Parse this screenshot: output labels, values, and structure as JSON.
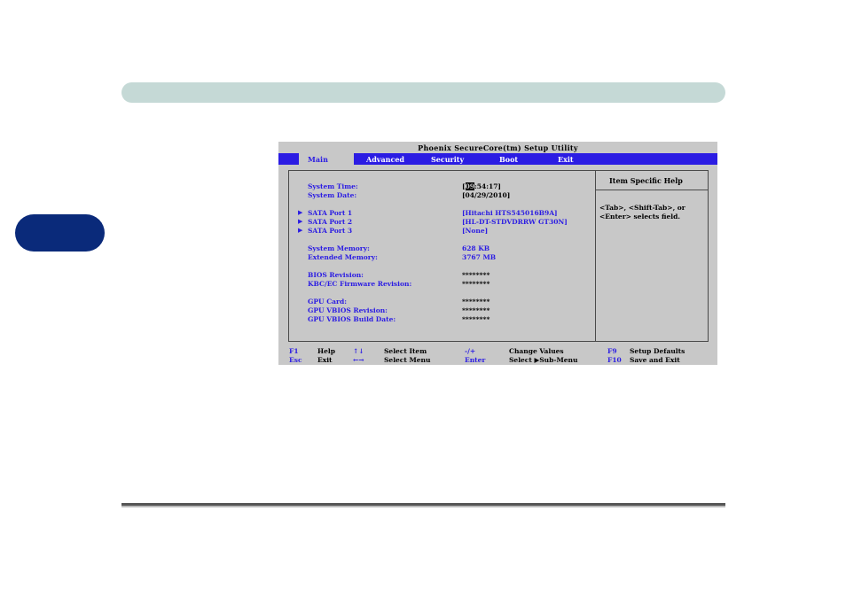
{
  "bios": {
    "title": "Phoenix SecureCore(tm) Setup Utility",
    "menu": [
      "Main",
      "Advanced",
      "Security",
      "Boot",
      "Exit"
    ],
    "active_menu": "Main",
    "help": {
      "title": "Item Specific Help",
      "text": "<Tab>, <Shift-Tab>, or <Enter> selects field."
    },
    "rows": [
      {
        "label": "System Time:",
        "value_hl": "09",
        "value_rest": ":54:17]",
        "value_prefix": "["
      },
      {
        "label": "System Date:",
        "value": "[04/29/2010]"
      },
      {
        "label": "SATA Port 1",
        "value": "[Hitachi HTS545016B9A]",
        "submenu": true
      },
      {
        "label": "SATA Port 2",
        "value": "[HL-DT-STDVDRRW GT30N]",
        "submenu": true
      },
      {
        "label": "SATA Port 3",
        "value": "[None]",
        "submenu": true
      },
      {
        "label": "System Memory:",
        "value": "628 KB"
      },
      {
        "label": "Extended Memory:",
        "value": "3767 MB"
      },
      {
        "label": "BIOS Revision:",
        "value": "********"
      },
      {
        "label": "KBC/EC Firmware Revision:",
        "value": "********"
      },
      {
        "label": "GPU Card:",
        "value": "********"
      },
      {
        "label": "GPU VBIOS Revision:",
        "value": "********"
      },
      {
        "label": "GPU VBIOS Build Date:",
        "value": "********"
      }
    ],
    "footer": {
      "row1": {
        "k1": "F1",
        "d1": "Help",
        "k2": "↑↓",
        "d2": "Select Item",
        "k3": "-/+",
        "d3": "Change Values",
        "k4": "F9",
        "d4": "Setup Defaults"
      },
      "row2": {
        "k1": "Esc",
        "d1": "Exit",
        "k2": "←→",
        "d2": "Select Menu",
        "k3": "Enter",
        "d3": "Select ▶Sub-Menu",
        "k4": "F10",
        "d4": "Save and Exit"
      }
    }
  }
}
